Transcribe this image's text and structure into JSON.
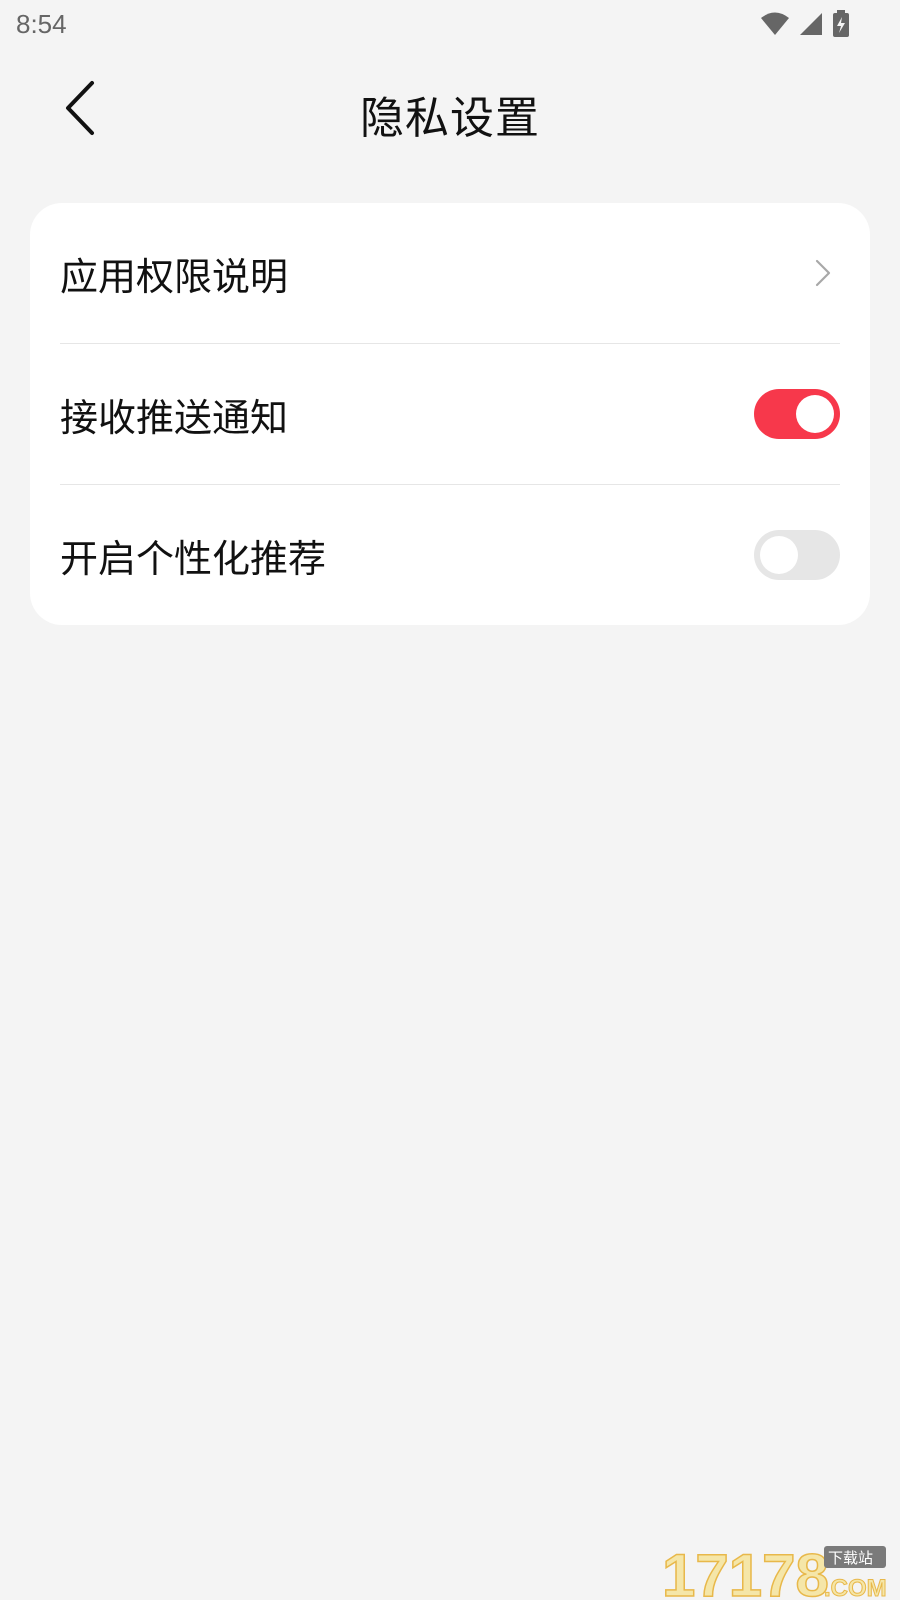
{
  "status_bar": {
    "time": "8:54",
    "icons": [
      "wifi-icon",
      "signal-icon",
      "battery-charging-icon"
    ]
  },
  "header": {
    "title": "隐私设置",
    "back_icon": "chevron-left-icon"
  },
  "settings": {
    "items": [
      {
        "label": "应用权限说明",
        "control": "chevron"
      },
      {
        "label": "接收推送通知",
        "control": "toggle",
        "value": "on"
      },
      {
        "label": "开启个性化推荐",
        "control": "toggle",
        "value": "off"
      }
    ]
  },
  "colors": {
    "background": "#f4f4f4",
    "card": "#ffffff",
    "accent": "#f7384b",
    "toggle_off": "#e6e6e6",
    "text": "#111111"
  },
  "watermark": {
    "text": "17178",
    "suffix": ".COM",
    "badge": "下载站"
  }
}
